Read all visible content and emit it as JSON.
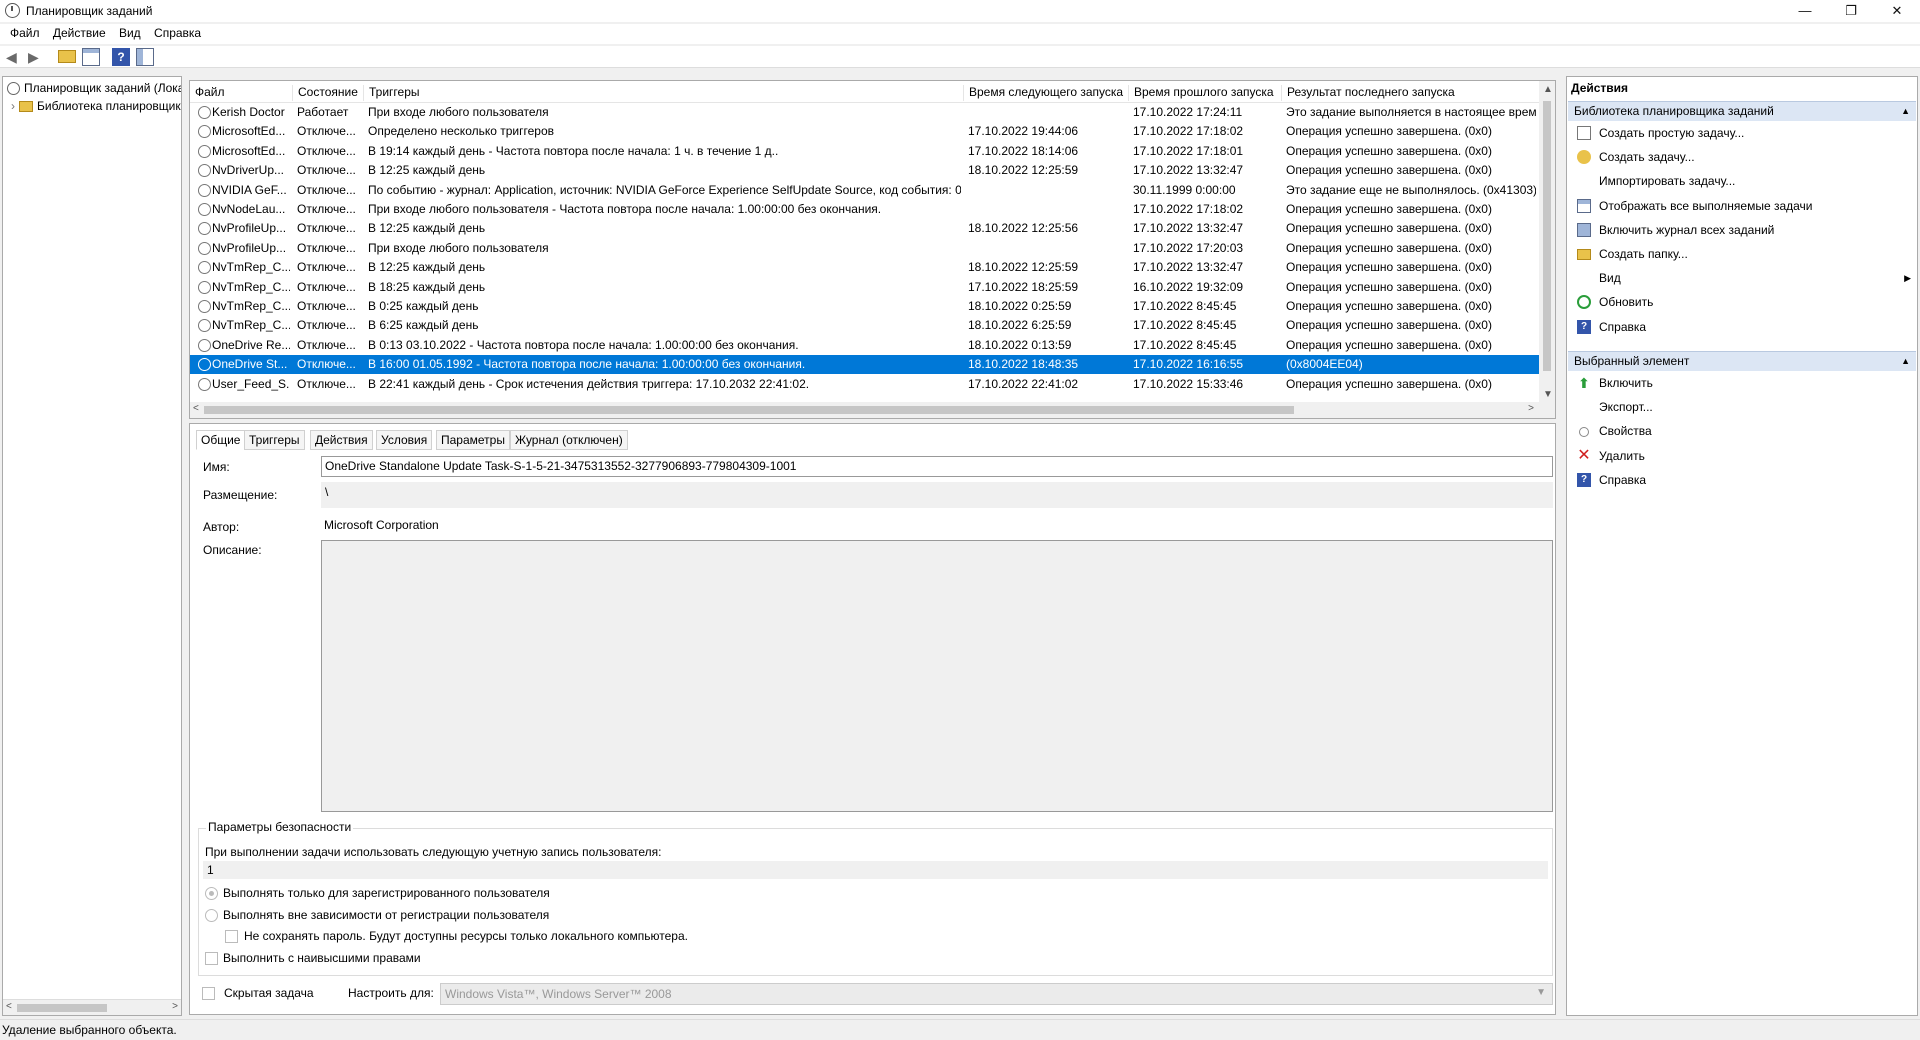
{
  "window": {
    "title": "Планировщик заданий",
    "minimize": "—",
    "restore": "❐",
    "close": "✕"
  },
  "menu": [
    "Файл",
    "Действие",
    "Вид",
    "Справка"
  ],
  "tree": {
    "root": "Планировщик заданий (Локальный)",
    "library": "Библиотека планировщика заданий",
    "expander": "›"
  },
  "tasks": {
    "columns": [
      "Файл",
      "Состояние",
      "Триггеры",
      "Время следующего запуска",
      "Время прошлого запуска",
      "Результат последнего запуска"
    ],
    "rows": [
      {
        "name": "Kerish Doctor",
        "state": "Работает",
        "trigger": "При входе любого пользователя",
        "next": "",
        "last": "17.10.2022 17:24:11",
        "result": "Это задание выполняется в настоящее время."
      },
      {
        "name": "MicrosoftEd...",
        "state": "Отключе...",
        "trigger": "Определено несколько триггеров",
        "next": "17.10.2022 19:44:06",
        "last": "17.10.2022 17:18:02",
        "result": "Операция успешно завершена. (0x0)"
      },
      {
        "name": "MicrosoftEd...",
        "state": "Отключе...",
        "trigger": "В 19:14 каждый день - Частота повтора после начала: 1 ч. в течение 1 д..",
        "next": "17.10.2022 18:14:06",
        "last": "17.10.2022 17:18:01",
        "result": "Операция успешно завершена. (0x0)"
      },
      {
        "name": "NvDriverUp...",
        "state": "Отключе...",
        "trigger": "В 12:25 каждый день",
        "next": "18.10.2022 12:25:59",
        "last": "17.10.2022 13:32:47",
        "result": "Операция успешно завершена. (0x0)"
      },
      {
        "name": "NVIDIA GeF...",
        "state": "Отключе...",
        "trigger": "По событию - журнал: Application, источник: NVIDIA GeForce Experience SelfUpdate Source, код события: 0",
        "next": "",
        "last": "30.11.1999 0:00:00",
        "result": "Это задание еще не выполнялось. (0x41303)"
      },
      {
        "name": "NvNodeLau...",
        "state": "Отключе...",
        "trigger": "При входе любого пользователя - Частота повтора после начала: 1.00:00:00 без окончания.",
        "next": "",
        "last": "17.10.2022 17:18:02",
        "result": "Операция успешно завершена. (0x0)"
      },
      {
        "name": "NvProfileUp...",
        "state": "Отключе...",
        "trigger": "В 12:25 каждый день",
        "next": "18.10.2022 12:25:56",
        "last": "17.10.2022 13:32:47",
        "result": "Операция успешно завершена. (0x0)"
      },
      {
        "name": "NvProfileUp...",
        "state": "Отключе...",
        "trigger": "При входе любого пользователя",
        "next": "",
        "last": "17.10.2022 17:20:03",
        "result": "Операция успешно завершена. (0x0)"
      },
      {
        "name": "NvTmRep_C...",
        "state": "Отключе...",
        "trigger": "В 12:25 каждый день",
        "next": "18.10.2022 12:25:59",
        "last": "17.10.2022 13:32:47",
        "result": "Операция успешно завершена. (0x0)"
      },
      {
        "name": "NvTmRep_C...",
        "state": "Отключе...",
        "trigger": "В 18:25 каждый день",
        "next": "17.10.2022 18:25:59",
        "last": "16.10.2022 19:32:09",
        "result": "Операция успешно завершена. (0x0)"
      },
      {
        "name": "NvTmRep_C...",
        "state": "Отключе...",
        "trigger": "В 0:25 каждый день",
        "next": "18.10.2022 0:25:59",
        "last": "17.10.2022 8:45:45",
        "result": "Операция успешно завершена. (0x0)"
      },
      {
        "name": "NvTmRep_C...",
        "state": "Отключе...",
        "trigger": "В 6:25 каждый день",
        "next": "18.10.2022 6:25:59",
        "last": "17.10.2022 8:45:45",
        "result": "Операция успешно завершена. (0x0)"
      },
      {
        "name": "OneDrive Re...",
        "state": "Отключе...",
        "trigger": "В 0:13 03.10.2022 - Частота повтора после начала: 1.00:00:00 без окончания.",
        "next": "18.10.2022 0:13:59",
        "last": "17.10.2022 8:45:45",
        "result": "Операция успешно завершена. (0x0)"
      },
      {
        "name": "OneDrive St...",
        "state": "Отключе...",
        "trigger": "В 16:00 01.05.1992 - Частота повтора после начала: 1.00:00:00 без окончания.",
        "next": "18.10.2022 18:48:35",
        "last": "17.10.2022 16:16:55",
        "result": "(0x8004EE04)",
        "selected": true
      },
      {
        "name": "User_Feed_S...",
        "state": "Отключе...",
        "trigger": "В 22:41 каждый день - Срок истечения действия триггера: 17.10.2032 22:41:02.",
        "next": "17.10.2022 22:41:02",
        "last": "17.10.2022 15:33:46",
        "result": "Операция успешно завершена. (0x0)"
      }
    ]
  },
  "detail": {
    "tabs": [
      "Общие",
      "Триггеры",
      "Действия",
      "Условия",
      "Параметры",
      "Журнал (отключен)"
    ],
    "name_label": "Имя:",
    "name_value": "OneDrive Standalone Update Task-S-1-5-21-3475313552-3277906893-779804309-1001",
    "location_label": "Размещение:",
    "location_value": "\\",
    "author_label": "Автор:",
    "author_value": "Microsoft Corporation",
    "description_label": "Описание:",
    "description_value": "",
    "security_title": "Параметры безопасности",
    "account_prompt": "При выполнении задачи использовать следующую учетную запись пользователя:",
    "account_value": "1",
    "radio_logged_on": "Выполнять только для зарегистрированного пользователя",
    "radio_any": "Выполнять вне зависимости от регистрации пользователя",
    "no_store_password": "Не сохранять пароль. Будут доступны ресурсы только локального компьютера.",
    "highest_privileges": "Выполнить с наивысшими правами",
    "hidden_task": "Скрытая задача",
    "configure_for_label": "Настроить для:",
    "configure_for_value": "Windows Vista™, Windows Server™ 2008"
  },
  "actions": {
    "title": "Действия",
    "section1": "Библиотека планировщика заданий",
    "items1": [
      {
        "label": "Создать простую задачу...",
        "icon": "task-icon"
      },
      {
        "label": "Создать задачу...",
        "icon": "new-task-icon"
      },
      {
        "label": "Импортировать задачу...",
        "icon": ""
      },
      {
        "label": "Отображать все выполняемые задачи",
        "icon": "view-icon"
      },
      {
        "label": "Включить журнал всех заданий",
        "icon": "log-icon"
      },
      {
        "label": "Создать папку...",
        "icon": "folder-icon"
      },
      {
        "label": "Вид",
        "icon": ""
      },
      {
        "label": "Обновить",
        "icon": "refresh-icon"
      },
      {
        "label": "Справка",
        "icon": "help-icon"
      }
    ],
    "section2": "Выбранный элемент",
    "items2": [
      {
        "label": "Включить",
        "icon": "enable-icon"
      },
      {
        "label": "Экспорт...",
        "icon": ""
      },
      {
        "label": "Свойства",
        "icon": "properties-icon"
      },
      {
        "label": "Удалить",
        "icon": "delete-icon"
      },
      {
        "label": "Справка",
        "icon": "help-icon"
      }
    ]
  },
  "status": "Удаление выбранного объекта."
}
